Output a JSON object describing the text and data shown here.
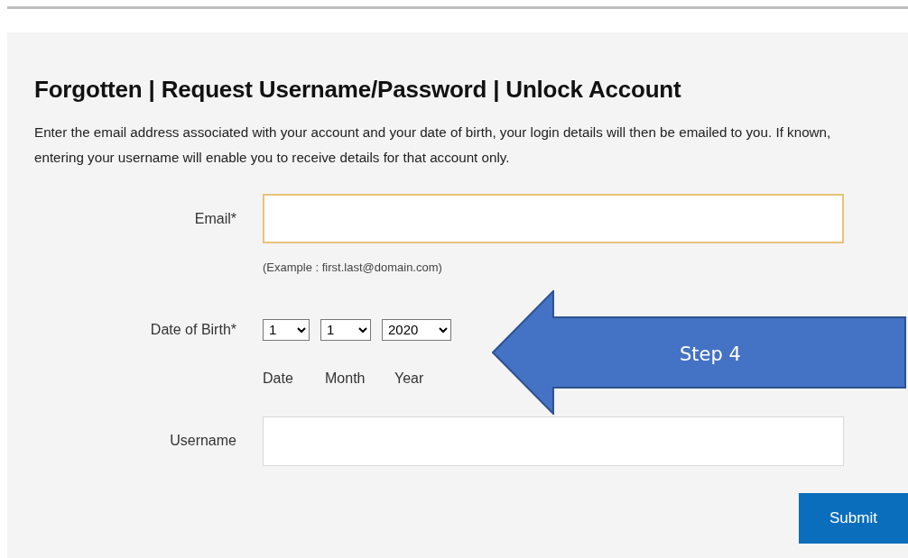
{
  "heading": "Forgotten | Request Username/Password | Unlock Account",
  "description": "Enter the email address associated with your account and your date of birth, your login details will then be emailed to you. If known, entering your username will enable you to receive details for that account only.",
  "email": {
    "label": "Email*",
    "focused": true,
    "hint": "(Example : first.last@domain.com)"
  },
  "date_of_birth": {
    "label": "Date of Birth*",
    "selects": [
      {
        "value": "1",
        "caption": "Date"
      },
      {
        "value": "1",
        "caption": "Month"
      },
      {
        "value": "2020",
        "caption": "Year"
      }
    ]
  },
  "username": {
    "label": "Username",
    "focused": false
  },
  "submit": "Submit",
  "callout": {
    "text": "Step 4"
  }
}
